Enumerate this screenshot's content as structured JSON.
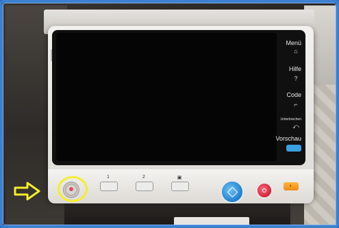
{
  "side_menu": {
    "items": [
      {
        "label": "Menü",
        "icon": "home-icon",
        "glyph": "⌂"
      },
      {
        "label": "Hilfe",
        "icon": "help-icon",
        "glyph": "?"
      },
      {
        "label": "Code",
        "icon": "key-icon",
        "glyph": "⌐"
      },
      {
        "label": "Unterbrechen",
        "icon": "interrupt-icon",
        "glyph": "⤺"
      },
      {
        "label": "Vorschau",
        "icon": "preview-icon",
        "glyph": ""
      }
    ]
  },
  "register_keys": [
    {
      "label": "1"
    },
    {
      "label": "2"
    },
    {
      "label": "▣"
    }
  ],
  "reset_glyph": "◐",
  "colors": {
    "frame_border": "#3d7fd0",
    "highlight_ring": "#f5ee2a",
    "start_button": "#1f7fd0",
    "stop_button": "#d0203a",
    "reset_button": "#ee8a10",
    "preview_button": "#3aa0e0"
  }
}
